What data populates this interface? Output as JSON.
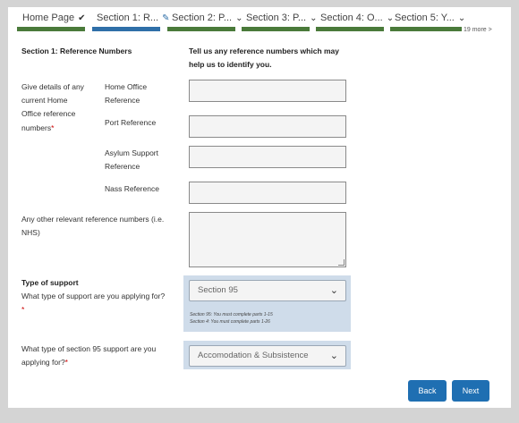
{
  "tabs": [
    {
      "label": "Home Page",
      "icon": "check-icon"
    },
    {
      "label": "Section 1: R...",
      "icon": "pencil-icon"
    },
    {
      "label": "Section 2: P...",
      "icon": "chevron-down-icon"
    },
    {
      "label": "Section 3: P...",
      "icon": "chevron-down-icon"
    },
    {
      "label": "Section 4: O...",
      "icon": "chevron-down-icon"
    },
    {
      "label": "Section 5: Y...",
      "icon": "chevron-down-icon"
    }
  ],
  "more_tabs": "19 more >",
  "section_heading": "Section 1: Reference Numbers",
  "intro": [
    "Tell us any reference numbers which may",
    "help us to identify you."
  ],
  "details_label": [
    "Give details of any",
    "current Home",
    "Office reference",
    "numbers"
  ],
  "required_mark": "*",
  "fields": {
    "home_office": [
      "Home Office",
      "Reference"
    ],
    "port": "Port Reference",
    "asylum": [
      "Asylum Support",
      "Reference"
    ],
    "nass": "Nass Reference",
    "other": [
      "Any other relevant reference numbers (i.e.",
      "NHS)"
    ]
  },
  "support": {
    "title": "Type of support",
    "question": "What type of support are you applying for?",
    "value": "Section 95",
    "hints": [
      "Section 95: You must complete parts 1-15",
      "Section 4: You must complete parts 1-26"
    ]
  },
  "s95": {
    "question": [
      "What type of section 95 support are you",
      "applying for?"
    ],
    "value": "Accomodation & Subsistence"
  },
  "buttons": {
    "back": "Back",
    "next": "Next"
  },
  "colors": {
    "active_tab": "#2f6fa8",
    "done_tab": "#4a7a3a",
    "button": "#1f6fb2"
  }
}
